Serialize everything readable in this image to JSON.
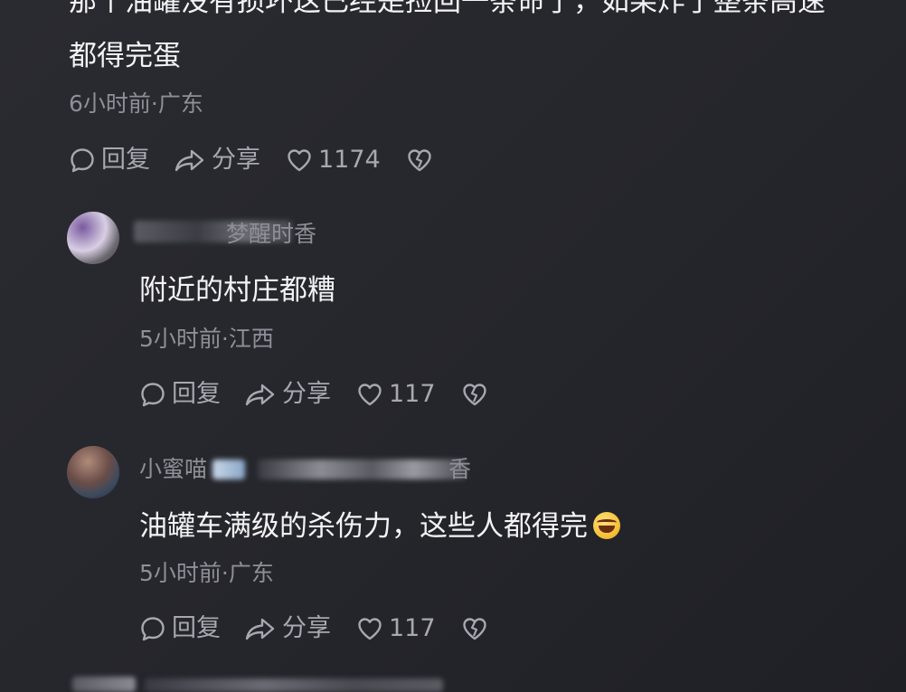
{
  "comments": [
    {
      "text_line1": "那个油罐没有损坏这已经是捡回一条命了，如果炸了整条高速",
      "text_line2": "都得完蛋",
      "meta": "6小时前·广东",
      "reply_label": "回复",
      "share_label": "分享",
      "likes": "1174"
    },
    {
      "username": "梦醒时香",
      "text": "附近的村庄都糟",
      "meta": "5小时前·江西",
      "reply_label": "回复",
      "share_label": "分享",
      "likes": "117"
    },
    {
      "username": "小蜜喵",
      "username_suffix": "香",
      "text": "油罐车满级的杀伤力，这些人都得完",
      "emoji": "rolling-on-floor-laughing-emoji",
      "meta": "5小时前·广东",
      "reply_label": "回复",
      "share_label": "分享",
      "likes": "117"
    }
  ],
  "icons": {
    "reply": "reply-bubble-icon",
    "share": "share-arrow-icon",
    "like": "heart-icon",
    "dislike": "broken-heart-icon"
  },
  "colors": {
    "background": "#25262c",
    "text": "#f3f3f5",
    "meta": "#8e8f97",
    "action": "#a7a8b0"
  }
}
